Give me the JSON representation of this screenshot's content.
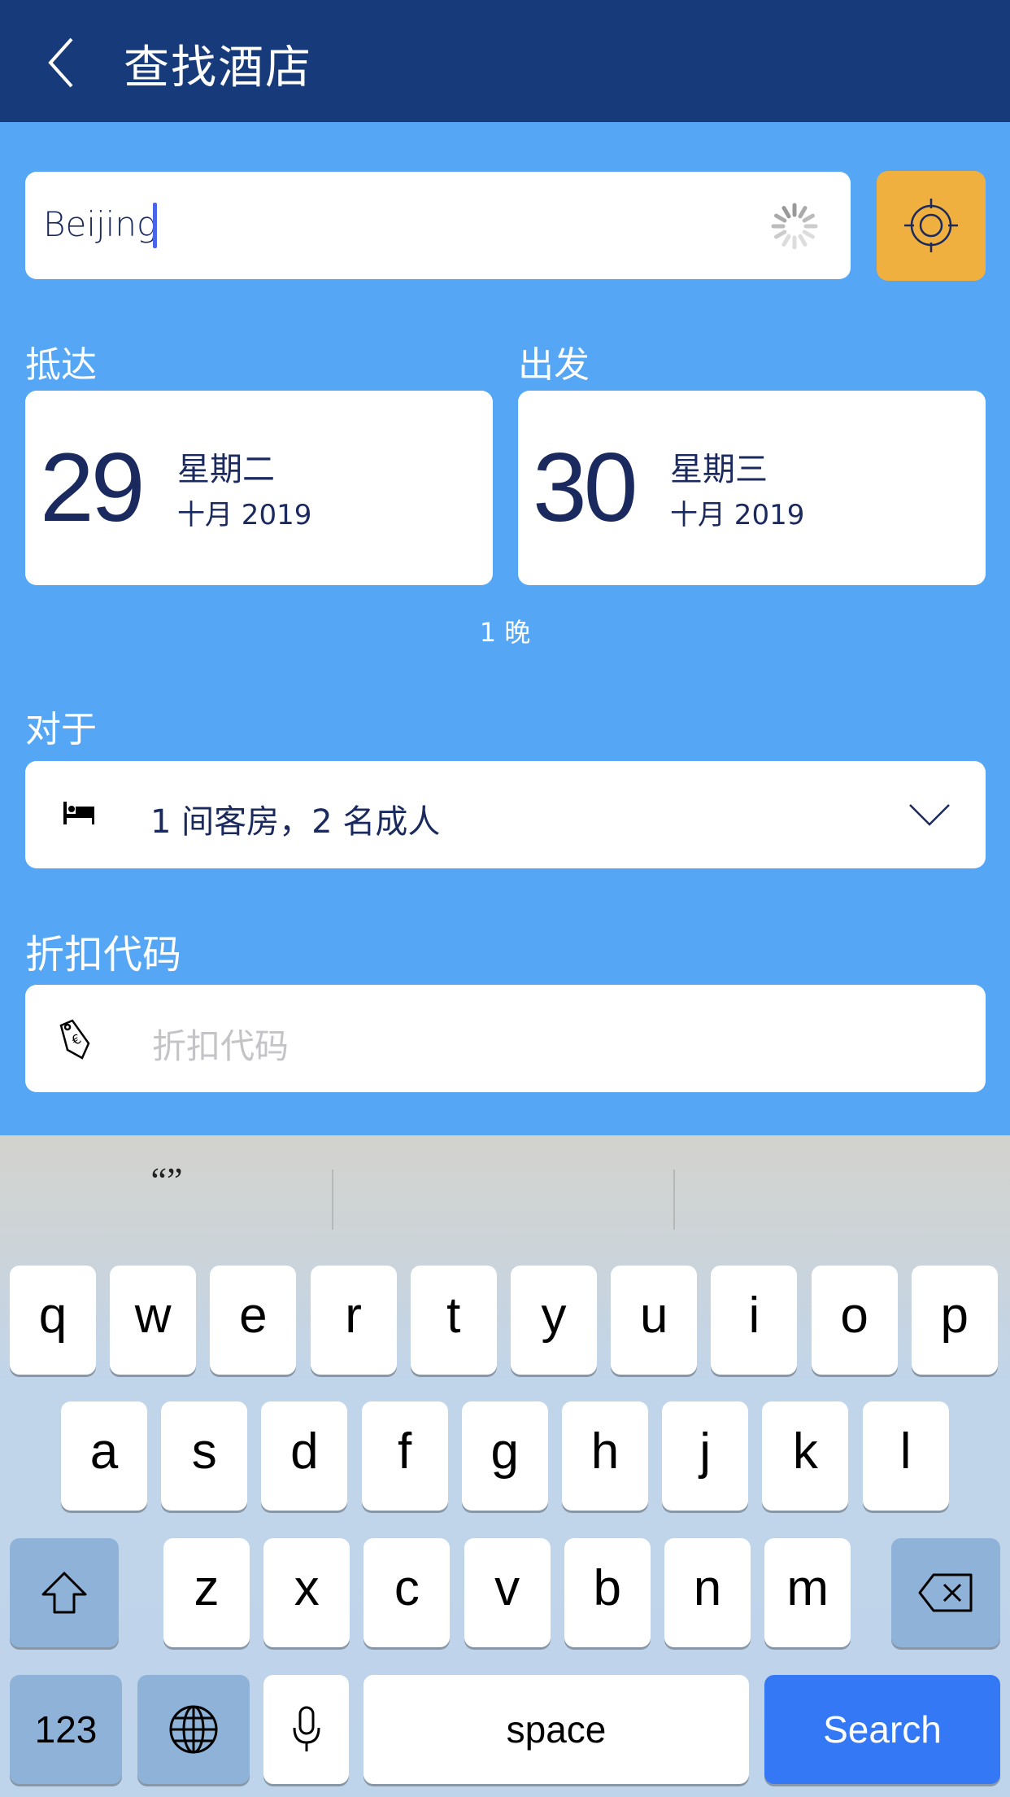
{
  "header": {
    "title": "查找酒店"
  },
  "search": {
    "value": "Beijing"
  },
  "arrival": {
    "label": "抵达",
    "day": "29",
    "weekday": "星期二",
    "month_year": "十月 2019"
  },
  "departure": {
    "label": "出发",
    "day": "30",
    "weekday": "星期三",
    "month_year": "十月 2019"
  },
  "nights": "1 晚",
  "guests": {
    "label": "对于",
    "value": "1 间客房，2 名成人"
  },
  "promo": {
    "label": "折扣代码",
    "placeholder": "折扣代码"
  },
  "keyboard": {
    "suggestion": "“”",
    "row1": [
      "q",
      "w",
      "e",
      "r",
      "t",
      "y",
      "u",
      "i",
      "o",
      "p"
    ],
    "row2": [
      "a",
      "s",
      "d",
      "f",
      "g",
      "h",
      "j",
      "k",
      "l"
    ],
    "row3": [
      "z",
      "x",
      "c",
      "v",
      "b",
      "n",
      "m"
    ],
    "numbers": "123",
    "space": "space",
    "search": "Search"
  },
  "colors": {
    "header": "#163a7a",
    "background": "#55a7f5",
    "locate": "#f0b040",
    "text": "#1b2a5e",
    "search_key": "#3478f6"
  }
}
